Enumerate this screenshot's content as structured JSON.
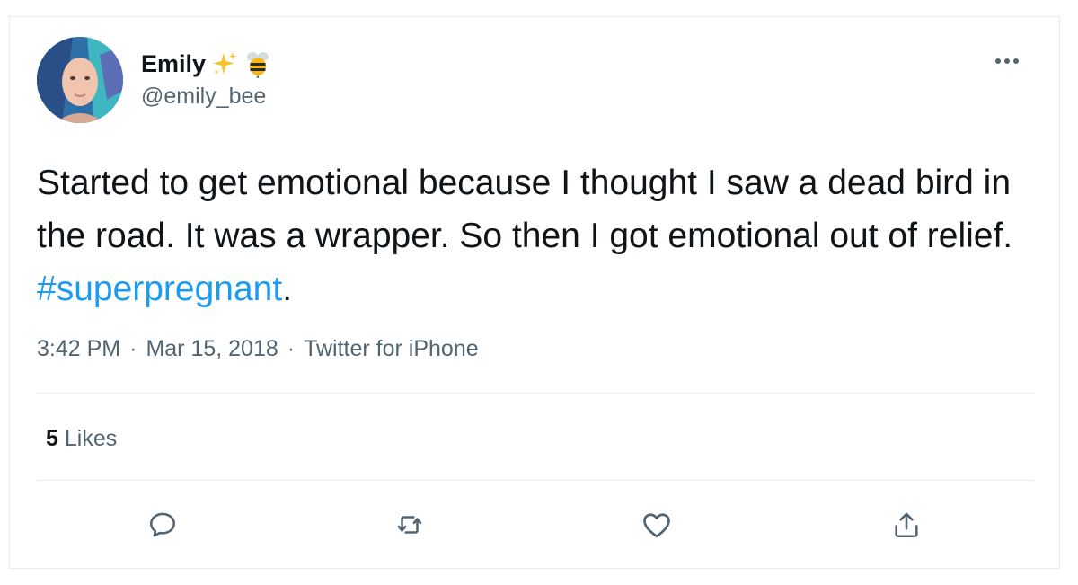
{
  "tweet": {
    "display_name": "Emily",
    "handle": "@emily_bee",
    "text_before": "Started to get emotional because I thought I saw a dead bird in the road. It was a wrapper. So then I got emotional out of relief. ",
    "hashtag": "#superpregnant",
    "text_after": ".",
    "time": "3:42 PM",
    "separator": "·",
    "date": "Mar 15, 2018",
    "source": "Twitter for iPhone",
    "likes_count": "5",
    "likes_label": "Likes"
  },
  "colors": {
    "link_blue": "#1d9bf0",
    "secondary_gray": "#536471",
    "divider": "#e6ecf0"
  },
  "icons": {
    "more": "more-dots-icon",
    "name_emoji_1": "sparkles-icon",
    "name_emoji_2": "bee-icon",
    "reply": "reply-icon",
    "retweet": "retweet-icon",
    "like": "heart-icon",
    "share": "share-icon"
  }
}
